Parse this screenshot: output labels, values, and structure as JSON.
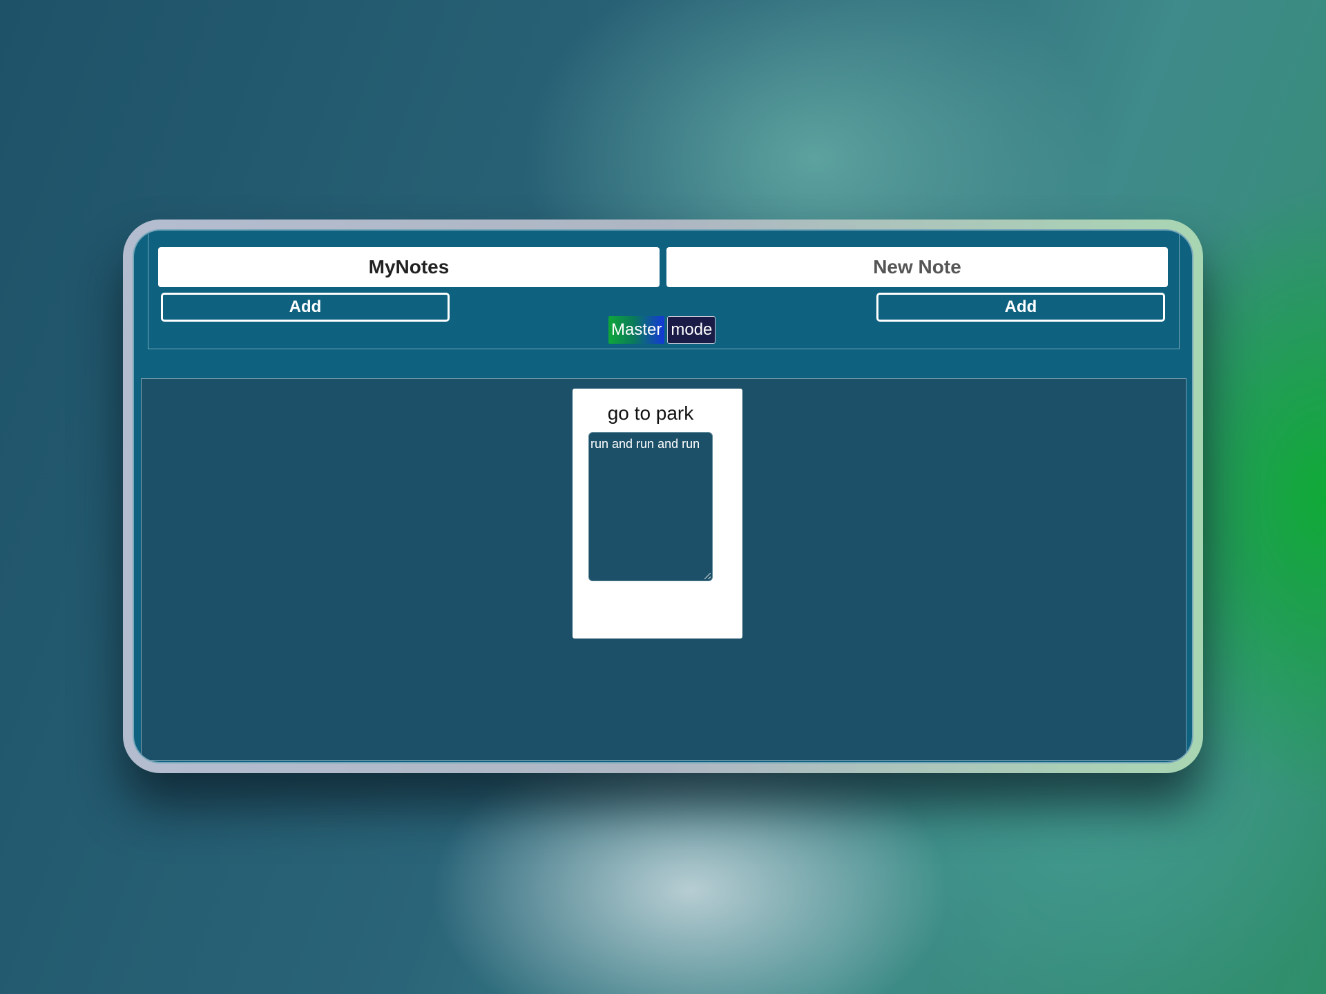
{
  "header": {
    "notes_title": "MyNotes",
    "new_note_placeholder": "New Note",
    "add_left_label": "Add",
    "add_right_label": "Add",
    "master_label": "Master",
    "mode_label": "mode"
  },
  "notes": [
    {
      "title": "go to park",
      "body": "run and run and run"
    }
  ],
  "colors": {
    "app_background": "#0e6280",
    "board_background": "#1c5068",
    "card_background": "#ffffff",
    "mode_button": "#1a1b47",
    "master_gradient_start": "#0fa63a",
    "master_gradient_end": "#1438d8"
  }
}
